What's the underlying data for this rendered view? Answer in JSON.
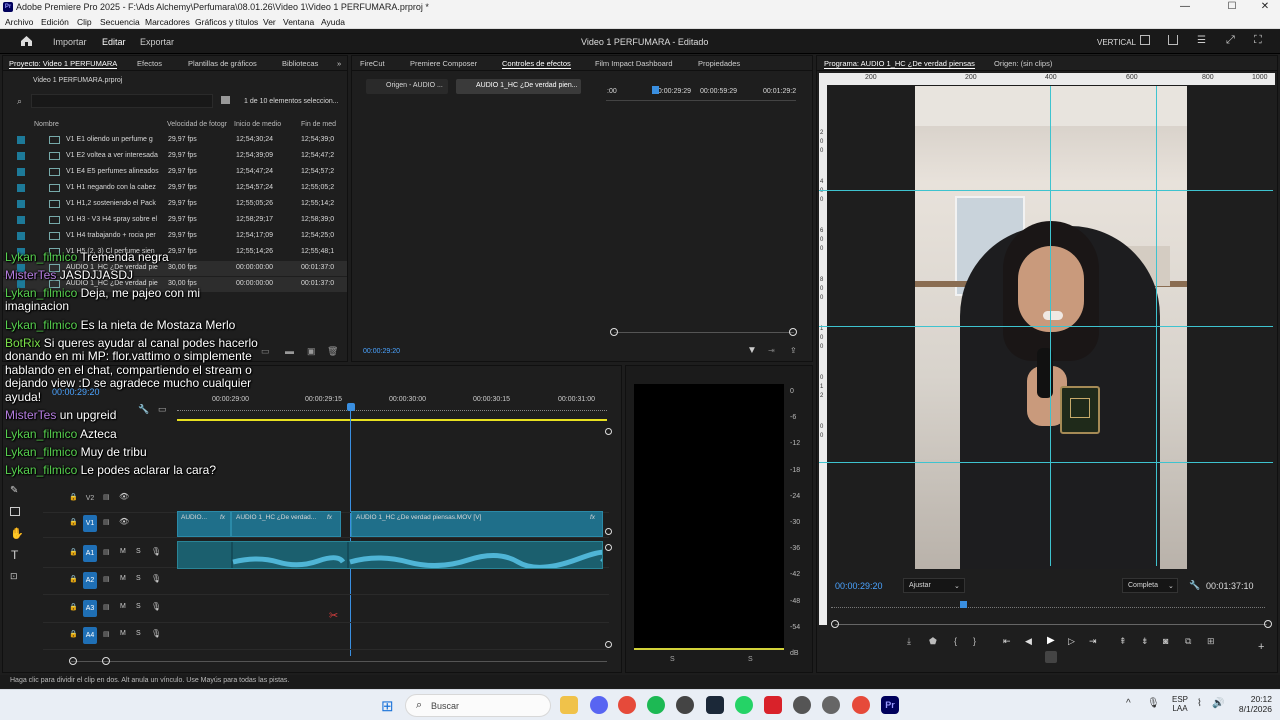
{
  "window": {
    "title": "Adobe Premiere Pro 2025 - F:\\Ads Alchemy\\Perfumara\\08.01.26\\Video 1\\Video 1 PERFUMARA.prproj *",
    "logo": "Pr",
    "minimize": "—",
    "maximize": "☐",
    "close": "✕"
  },
  "menu": [
    "Archivo",
    "Edición",
    "Clip",
    "Secuencia",
    "Marcadores",
    "Gráficos y títulos",
    "Ver",
    "Ventana",
    "Ayuda"
  ],
  "header": {
    "home_icon": "home-icon",
    "tabs": [
      "Importar",
      "Editar",
      "Exportar"
    ],
    "active_tab": "Editar",
    "center_title": "Video 1 PERFUMARA",
    "status": "Editado",
    "layout": "VERTICAL"
  },
  "project": {
    "tabs": [
      "Proyecto: Video 1 PERFUMARA",
      "Efectos",
      "Plantillas de gráficos",
      "Bibliotecas"
    ],
    "file": "Video 1 PERFUMARA.prproj",
    "search_placeholder": "",
    "count": "1 de 10 elementos seleccion...",
    "columns": [
      "Nombre",
      "Velocidad de fotogr",
      "Inicio de medio",
      "Fin de med"
    ],
    "rows": [
      {
        "name": "V1 E1 oliendo un perfume g",
        "fps": "29,97 fps",
        "start": "12;54;30;24",
        "end": "12;54;39;0"
      },
      {
        "name": "V1 E2 voltea a ver interesada",
        "fps": "29,97 fps",
        "start": "12;54;39;09",
        "end": "12;54;47;2"
      },
      {
        "name": "V1 E4 E5 perfumes alineados",
        "fps": "29,97 fps",
        "start": "12;54;47;24",
        "end": "12;54;57;2"
      },
      {
        "name": "V1 H1 negando con la cabez",
        "fps": "29,97 fps",
        "start": "12;54;57;24",
        "end": "12;55;05;2"
      },
      {
        "name": "V1 H1,2 sosteniendo el Pack",
        "fps": "29,97 fps",
        "start": "12;55;05;26",
        "end": "12;55;14;2"
      },
      {
        "name": "V1 H3 - V3 H4 spray sobre el",
        "fps": "29,97 fps",
        "start": "12;58;29;17",
        "end": "12;58;39;0"
      },
      {
        "name": "V1 H4 trabajando + rocia per",
        "fps": "29,97 fps",
        "start": "12;54;17;09",
        "end": "12;54;25;0"
      },
      {
        "name": "V1 H5 (2, 3) Cl perfume sien",
        "fps": "29,97 fps",
        "start": "12;55;14;26",
        "end": "12;55;48;1"
      },
      {
        "name": "AUDIO 1_HC ¿De verdad pie",
        "fps": "30,00 fps",
        "start": "00:00:00:00",
        "end": "00:01:37:0"
      },
      {
        "name": "AUDIO 1_HC ¿De verdad pie",
        "fps": "30,00 fps",
        "start": "00:00:00:00",
        "end": "00:01:37:0"
      }
    ]
  },
  "effects": {
    "tabs": [
      "FireCut",
      "Premiere Composer",
      "Controles de efectos",
      "Film Impact Dashboard",
      "Propiedades"
    ],
    "subtabs": [
      "Origen - AUDIO ...",
      "AUDIO 1_HC ¿De verdad pien..."
    ],
    "ruler": [
      ":00",
      "00:00:29:29",
      "00:00:59:29",
      "00:01:29:2"
    ],
    "timecode": "00:00:29:20"
  },
  "timeline": {
    "timecode": "00:00:29:20",
    "ruler": [
      "00:00:29:00",
      "00:00:29:15",
      "00:00:30:00",
      "00:00:30:15",
      "00:00:31:00"
    ],
    "tracks": [
      {
        "id": "V2"
      },
      {
        "id": "V1"
      },
      {
        "id": "A1"
      },
      {
        "id": "A2"
      },
      {
        "id": "A3"
      },
      {
        "id": "A4"
      }
    ],
    "track_buttons": {
      "m": "M",
      "s": "S"
    },
    "clips_v1": [
      "AUDIO...",
      "AUDIO 1_HC ¿De verdad...",
      "AUDIO 1_HC ¿De verdad piensas.MOV [V]"
    ],
    "fx": "fx"
  },
  "meter": {
    "labels": [
      "0",
      "-6",
      "-12",
      "-18",
      "-24",
      "-30",
      "-36",
      "-42",
      "-48",
      "-54",
      "dB"
    ],
    "s1": "S",
    "s2": "S"
  },
  "program": {
    "tabs": [
      "Programa: AUDIO 1_HC ¿De verdad piensas",
      "Origen: (sin clips)"
    ],
    "ruler": [
      "200",
      "200",
      "400",
      "600",
      "800",
      "1000"
    ],
    "vruler": [
      "2",
      "0",
      "0",
      "4",
      "0",
      "0",
      "6",
      "0",
      "0",
      "8",
      "0",
      "0",
      "1",
      "0",
      "0",
      "0",
      "1",
      "2",
      "0",
      "0"
    ],
    "timecode": "00:00:29:20",
    "fit": "Ajustar",
    "quality": "Completa",
    "duration": "00:01:37:10"
  },
  "status_bar": "Haga clic para dividir el clip en dos. Alt anula un vínculo. Use Mayús para todas las pistas.",
  "chat": [
    {
      "user": "Lykan_filmico",
      "color": "u1",
      "msg": "Tremenda negra"
    },
    {
      "user": "MisterTes",
      "color": "u2",
      "msg": "JASDJJASDJ"
    },
    {
      "user": "Lykan_filmico",
      "color": "u1",
      "msg": "Deja, me pajeo con mi"
    },
    {
      "user": "",
      "color": "u1",
      "msg": "imaginacion"
    },
    {
      "user": "Lykan_filmico",
      "color": "u1",
      "msg": "Es la nieta de Mostaza Merlo"
    },
    {
      "user": "BotRix",
      "color": "u3",
      "msg": "Si queres ayudar al canal podes hacerlo"
    },
    {
      "user": "",
      "color": "u3",
      "msg": "donando en mi MP: flor.vattimo o simplemente"
    },
    {
      "user": "",
      "color": "u3",
      "msg": "hablando en el chat, compartiendo el stream o"
    },
    {
      "user": "",
      "color": "u3",
      "msg": "dejando view :D se agradece mucho cualquier"
    },
    {
      "user": "",
      "color": "u3",
      "msg": "ayuda!"
    },
    {
      "user": "MisterTes",
      "color": "u2",
      "msg": "un upgreid"
    },
    {
      "user": "Lykan_filmico",
      "color": "u1",
      "msg": "Azteca"
    },
    {
      "user": "Lykan_filmico",
      "color": "u1",
      "msg": "Muy de tribu"
    },
    {
      "user": "Lykan_filmico",
      "color": "u1",
      "msg": "Le podes aclarar la cara?"
    }
  ],
  "taskbar": {
    "search": "Buscar",
    "lang1": "ESP",
    "lang2": "LAA",
    "time": "20:12",
    "date": "8/1/2026"
  }
}
